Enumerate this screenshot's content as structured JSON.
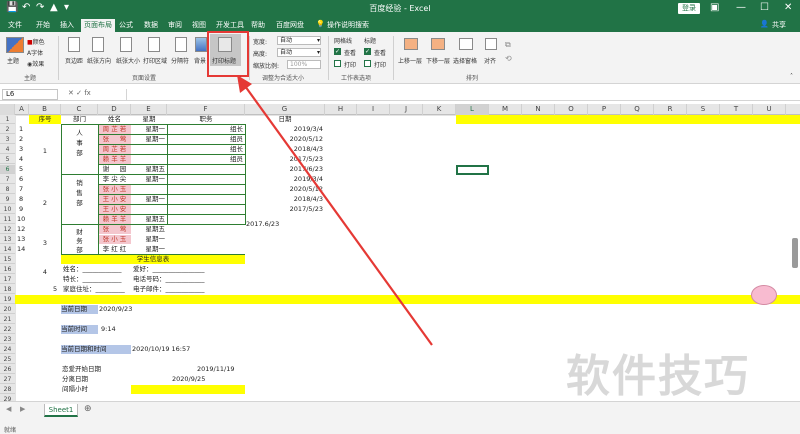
{
  "window": {
    "title": "百度经验 - Excel",
    "login_label": "登录",
    "share_label": "共享"
  },
  "tabs": [
    "文件",
    "开始",
    "插入",
    "页面布局",
    "公式",
    "数据",
    "审阅",
    "视图",
    "开发工具",
    "帮助",
    "百度网盘",
    "操作说明搜索"
  ],
  "ribbon": {
    "themes": {
      "theme_label": "主题",
      "colors": "颜色",
      "fonts": "字体",
      "effects": "效果",
      "group": "主题"
    },
    "page_setup": {
      "margins": "页边距",
      "orientation": "纸张方向",
      "size": "纸张大小",
      "print_area": "打印区域",
      "breaks": "分隔符",
      "background": "背景",
      "print_titles": "打印标题",
      "group": "页面设置"
    },
    "scale": {
      "width_label": "宽度:",
      "width_value": "自动",
      "height_label": "高度:",
      "height_value": "自动",
      "scale_label": "缩放比例:",
      "scale_value": "100%",
      "group": "调整为合适大小"
    },
    "sheet_options": {
      "gridlines": "网格线",
      "headings": "标题",
      "view": "查看",
      "print": "打印",
      "group": "工作表选项"
    },
    "arrange": {
      "bring_forward": "上移一层",
      "send_backward": "下移一层",
      "selection_pane": "选择窗格",
      "align": "对齐",
      "group": "排列"
    }
  },
  "formula_bar": {
    "name_box": "L6",
    "fx": "fx",
    "formula": ""
  },
  "columns": [
    "A",
    "B",
    "C",
    "D",
    "E",
    "F",
    "G",
    "H",
    "I",
    "J",
    "K",
    "L",
    "M",
    "N",
    "O",
    "P",
    "Q",
    "R",
    "S",
    "T",
    "U"
  ],
  "rows": [
    "1",
    "2",
    "3",
    "4",
    "5",
    "6",
    "7",
    "8",
    "9",
    "10",
    "11",
    "12",
    "13",
    "14",
    "15",
    "16",
    "17",
    "18",
    "19",
    "20",
    "21",
    "22",
    "23",
    "24",
    "25",
    "26",
    "27",
    "28",
    "29"
  ],
  "cells": {
    "b1": "序号",
    "c1": "部门",
    "d1": "姓名",
    "e1": "星期",
    "f1": "职务",
    "g1": "日期",
    "a2": "1",
    "a3": "2",
    "a4": "3",
    "a5": "4",
    "a6": "5",
    "a7": "6",
    "a8": "7",
    "a9": "8",
    "a10": "9",
    "a11": "10",
    "a12": "12",
    "a13": "13",
    "a14": "14",
    "b_group1": "1",
    "b_group2": "2",
    "b_group3": "3",
    "b_group4": "4",
    "a18": "5",
    "dept1": "人\n事\n部",
    "dept2": "销\n售\n部",
    "dept3": "财\n务\n部",
    "names": [
      "周 芷 若",
      "张 　 莺",
      "周 芷 若",
      "赖 羊 羊",
      "谢 　 园",
      "李 尖 尖",
      "张 小 玉",
      "王 小 安",
      "王 小 安",
      "赖 羊 羊",
      "张 　 莺",
      "张 小 玉",
      "李 红 红"
    ],
    "weekdays": [
      "星期一",
      "星期一",
      "",
      "",
      "星期五",
      "星期一",
      "",
      "星期一",
      "",
      "星期五",
      "星期五",
      "星期一",
      "星期一"
    ],
    "jobs": [
      "组长",
      "组员",
      "组长",
      "组员",
      "",
      "",
      "",
      "",
      "",
      "",
      "",
      "",
      ""
    ],
    "dates": [
      "2019/3/4",
      "2020/5/12",
      "2018/4/3",
      "2017/5/23",
      "2017/6/23",
      "2019/3/4",
      "2020/5/12",
      "2018/4/3",
      "2017/5/23",
      "2017.6/23"
    ],
    "r15": "学生信息表",
    "r16_name": "姓名：",
    "r16_hobby": "爱好：",
    "r17_skill": "特长：",
    "r17_phone": "电话号码：",
    "r18_addr": "家庭住址：",
    "r18_email": "电子邮件：",
    "r20_label": "当前日期",
    "r20_value": "2020/9/23",
    "r22_label": "当前时间",
    "r22_value": "9:14",
    "r24_label": "当前日期和时间",
    "r24_value": "2020/10/19 16:57",
    "r26_label": "恋爱开始日期",
    "r26_value": "2019/11/19",
    "r27_label": "分离日期",
    "r27_value": "2020/9/25",
    "r28_label": "间隔小时"
  },
  "sheet_tab": "Sheet1",
  "status": "就绪",
  "watermark": "软件技巧",
  "colors": {
    "excel_green": "#217346",
    "highlight_red": "#e53935",
    "yellow": "#ffff00",
    "pink": "#f4c7ce",
    "blue": "#b4c6e7"
  }
}
